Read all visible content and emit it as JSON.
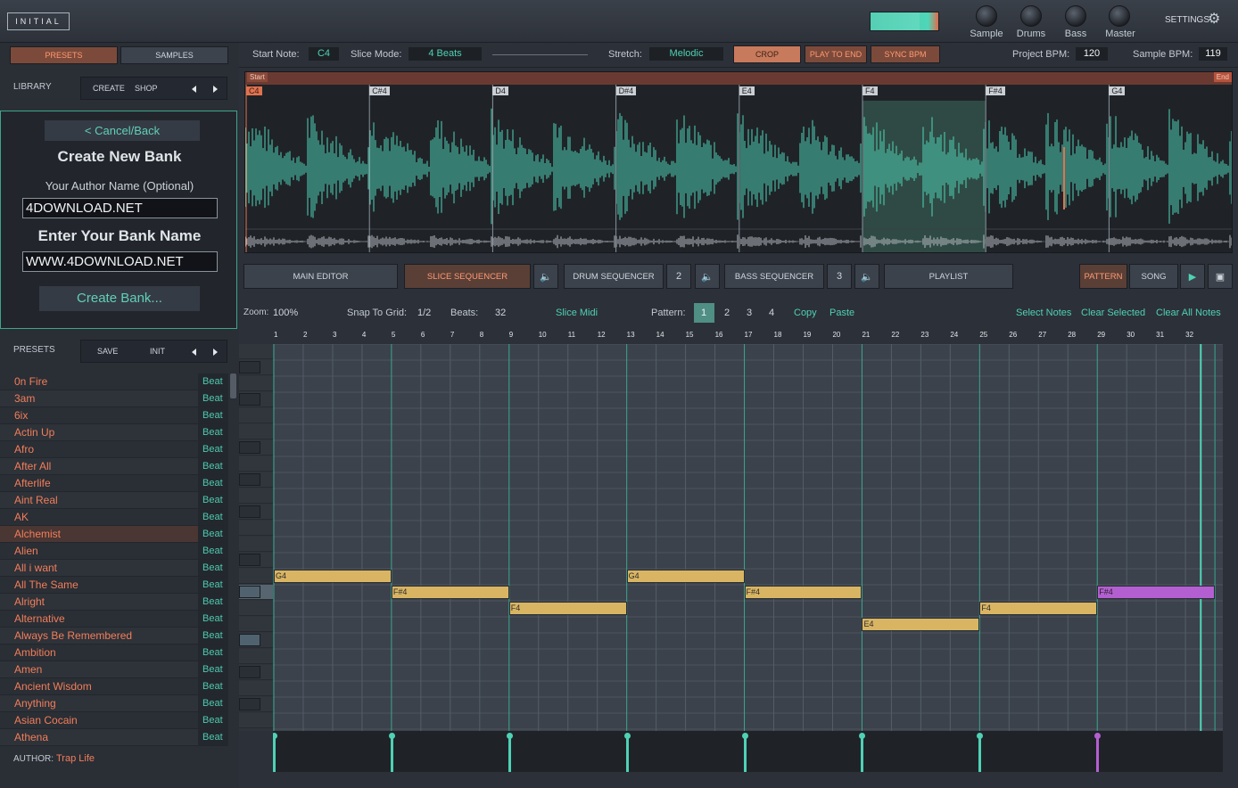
{
  "top": {
    "logo": "INITIAL",
    "knobs": [
      "Sample",
      "Drums",
      "Bass",
      "Master"
    ],
    "settings_label": "SETTINGS"
  },
  "left": {
    "presets_tab": "PRESETS",
    "samples_tab": "SAMPLES",
    "library_label": "LIBRARY",
    "create_btn": "CREATE",
    "shop_btn": "SHOP",
    "bank": {
      "cancel_label": "< Cancel/Back",
      "title": "Create New Bank",
      "author_label": "Your Author Name (Optional)",
      "author_value": "4DOWNLOAD.NET",
      "bank_label": "Enter Your Bank Name",
      "bank_value": "WWW.4DOWNLOAD.NET",
      "create_label": "Create Bank..."
    },
    "presets_label": "PRESETS",
    "save_btn": "SAVE",
    "init_btn": "INIT",
    "presets": [
      {
        "name": "0n Fire",
        "type": "Beat"
      },
      {
        "name": "3am",
        "type": "Beat"
      },
      {
        "name": "6ix",
        "type": "Beat"
      },
      {
        "name": "Actin Up",
        "type": "Beat"
      },
      {
        "name": "Afro",
        "type": "Beat"
      },
      {
        "name": "After All",
        "type": "Beat"
      },
      {
        "name": "Afterlife",
        "type": "Beat"
      },
      {
        "name": "Aint Real",
        "type": "Beat"
      },
      {
        "name": "AK",
        "type": "Beat"
      },
      {
        "name": "Alchemist",
        "type": "Beat",
        "selected": true
      },
      {
        "name": "Alien",
        "type": "Beat"
      },
      {
        "name": "All i want",
        "type": "Beat"
      },
      {
        "name": "All The Same",
        "type": "Beat"
      },
      {
        "name": "Alright",
        "type": "Beat"
      },
      {
        "name": "Alternative",
        "type": "Beat"
      },
      {
        "name": "Always Be Remembered",
        "type": "Beat"
      },
      {
        "name": "Ambition",
        "type": "Beat"
      },
      {
        "name": "Amen",
        "type": "Beat"
      },
      {
        "name": "Ancient Wisdom",
        "type": "Beat"
      },
      {
        "name": "Anything",
        "type": "Beat"
      },
      {
        "name": "Asian Cocain",
        "type": "Beat"
      },
      {
        "name": "Athena",
        "type": "Beat"
      }
    ],
    "author_label": "AUTHOR:",
    "author_value": "Trap Life"
  },
  "toolbar": {
    "start_note_label": "Start Note:",
    "start_note": "C4",
    "slice_mode_label": "Slice Mode:",
    "slice_mode": "4 Beats",
    "stretch_label": "Stretch:",
    "stretch": "Melodic",
    "crop": "CROP",
    "play_to_end": "PLAY TO END",
    "sync_bpm": "SYNC BPM",
    "project_bpm_label": "Project BPM:",
    "project_bpm": "120",
    "sample_bpm_label": "Sample BPM:",
    "sample_bpm": "119"
  },
  "wave": {
    "start": "Start",
    "end": "End",
    "slices": [
      "C4",
      "C#4",
      "D4",
      "D#4",
      "E4",
      "F4",
      "F#4",
      "G4"
    ]
  },
  "tabs": {
    "main_editor": "MAIN EDITOR",
    "slice_sequencer": "SLICE SEQUENCER",
    "drum_sequencer": "DRUM SEQUENCER",
    "drum_num": "2",
    "bass_sequencer": "BASS SEQUENCER",
    "bass_num": "3",
    "playlist": "PLAYLIST",
    "pattern": "PATTERN",
    "song": "SONG"
  },
  "pianoroll": {
    "zoom_label": "Zoom:",
    "zoom": "100%",
    "snap_label": "Snap To Grid:",
    "snap": "1/2",
    "beats_label": "Beats:",
    "beats": "32",
    "slice_midi": "Slice Midi",
    "pattern_label": "Pattern:",
    "patterns": [
      "1",
      "2",
      "3",
      "4"
    ],
    "copy": "Copy",
    "paste": "Paste",
    "select_notes": "Select Notes",
    "clear_selected": "Clear Selected",
    "clear_all": "Clear All Notes",
    "ruler": [
      "1",
      "2",
      "3",
      "4",
      "5",
      "6",
      "7",
      "8",
      "9",
      "10",
      "11",
      "12",
      "13",
      "14",
      "15",
      "16",
      "17",
      "18",
      "19",
      "20",
      "21",
      "22",
      "23",
      "24",
      "25",
      "26",
      "27",
      "28",
      "29",
      "30",
      "31",
      "32"
    ],
    "notes": [
      {
        "label": "G4",
        "start": 1,
        "len": 4,
        "pitch": "G4"
      },
      {
        "label": "F#4",
        "start": 5,
        "len": 4,
        "pitch": "F#4"
      },
      {
        "label": "F4",
        "start": 9,
        "len": 4,
        "pitch": "F4"
      },
      {
        "label": "G4",
        "start": 13,
        "len": 4,
        "pitch": "G4"
      },
      {
        "label": "F#4",
        "start": 17,
        "len": 4,
        "pitch": "F#4"
      },
      {
        "label": "E4",
        "start": 21,
        "len": 4,
        "pitch": "E4"
      },
      {
        "label": "F4",
        "start": 25,
        "len": 4,
        "pitch": "F4"
      },
      {
        "label": "F#4",
        "start": 29,
        "len": 4,
        "pitch": "F#4",
        "color": "#b45fd1"
      }
    ]
  },
  "colors": {
    "accent": "#4fd1b4",
    "orange": "#f27e5a",
    "note": "#d9b563",
    "note_selected": "#b45fd1"
  }
}
